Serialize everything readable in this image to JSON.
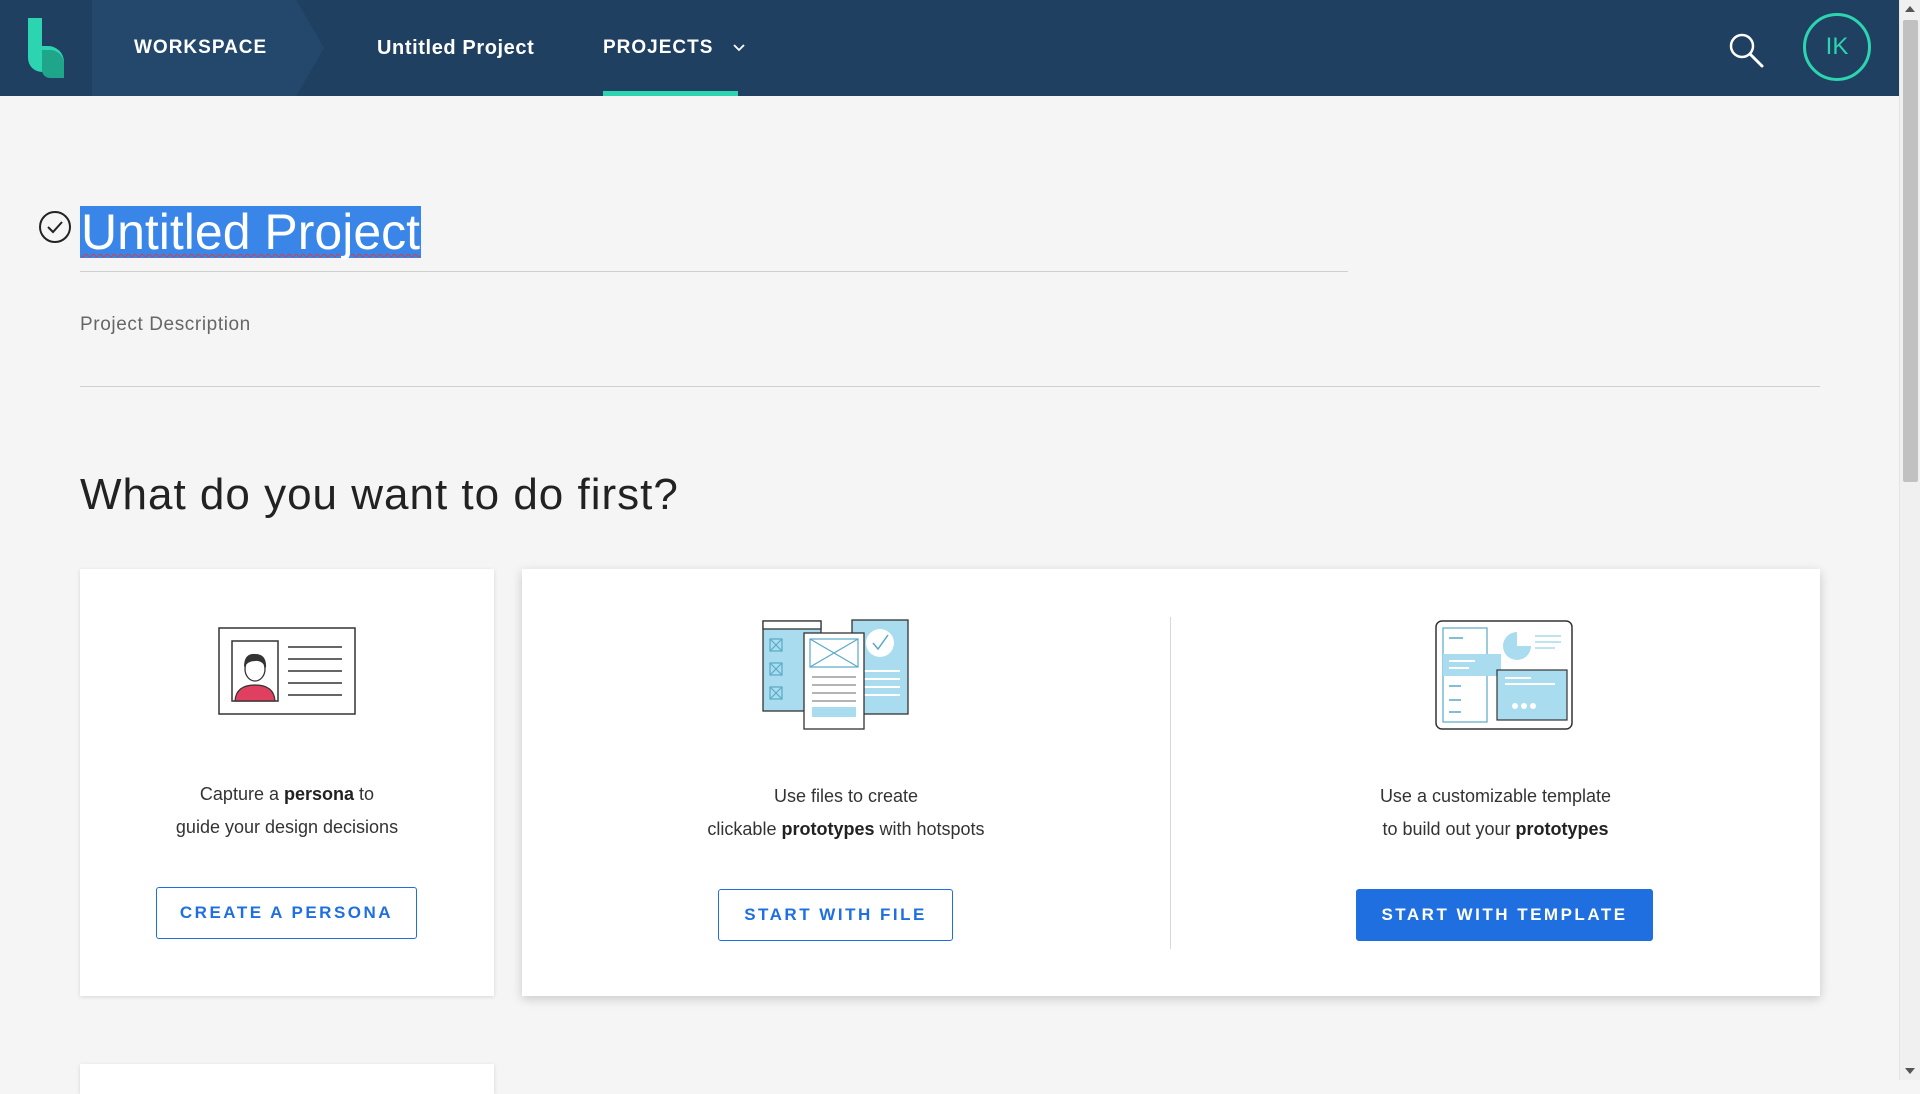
{
  "header": {
    "workspace_label": "WORKSPACE",
    "project_label": "Untitled Project",
    "projects_label": "PROJECTS",
    "avatar_initials": "IK"
  },
  "project": {
    "title": "Untitled Project",
    "description_placeholder": "Project Description"
  },
  "prompt": {
    "heading": "What do you want to do first?"
  },
  "cards": {
    "persona": {
      "text_pre": "Capture a",
      "text_bold": "persona",
      "text_post": "to",
      "text_line2": "guide your design decisions",
      "button_label": "CREATE A PERSONA"
    },
    "file": {
      "text_line1": "Use files to create",
      "text_pre": "clickable",
      "text_bold": "prototypes",
      "text_post": "with hotspots",
      "button_label": "START WITH FILE"
    },
    "template": {
      "text_line1": "Use a customizable template",
      "text_pre": "to build out your",
      "text_bold": "prototypes",
      "button_label": "START WITH TEMPLATE"
    }
  },
  "colors": {
    "header_bg": "#1f4061",
    "accent_teal": "#2cd4b0",
    "primary_blue": "#1f6fe0",
    "selection_blue": "#3a86e8",
    "illustration_blue": "#a9dcee"
  },
  "icons": [
    "logo-icon",
    "chevron-down-icon",
    "search-icon",
    "check-circle-icon",
    "persona-card-illustration",
    "file-prototype-illustration",
    "template-illustration"
  ]
}
